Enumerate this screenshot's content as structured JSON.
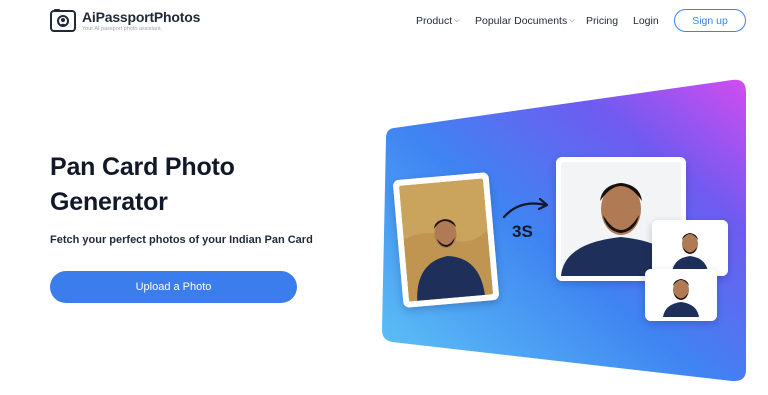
{
  "brand": {
    "name": "AiPassportPhotos",
    "tagline": "Your AI passport photo assistant."
  },
  "nav": {
    "product": "Product",
    "popular_documents": "Popular Documents",
    "pricing": "Pricing",
    "login": "Login",
    "signup": "Sign up"
  },
  "hero": {
    "title": "Pan Card Photo Generator",
    "subtitle": "Fetch your perfect photos of your Indian Pan Card",
    "upload_button": "Upload a Photo"
  },
  "illustration": {
    "timer_label": "3S",
    "gradient_colors": [
      "#60c0f8",
      "#3b82f6",
      "#7c4dff",
      "#d946ef"
    ]
  },
  "colors": {
    "accent": "#3b7ded",
    "signup_border": "#3b82f6"
  }
}
